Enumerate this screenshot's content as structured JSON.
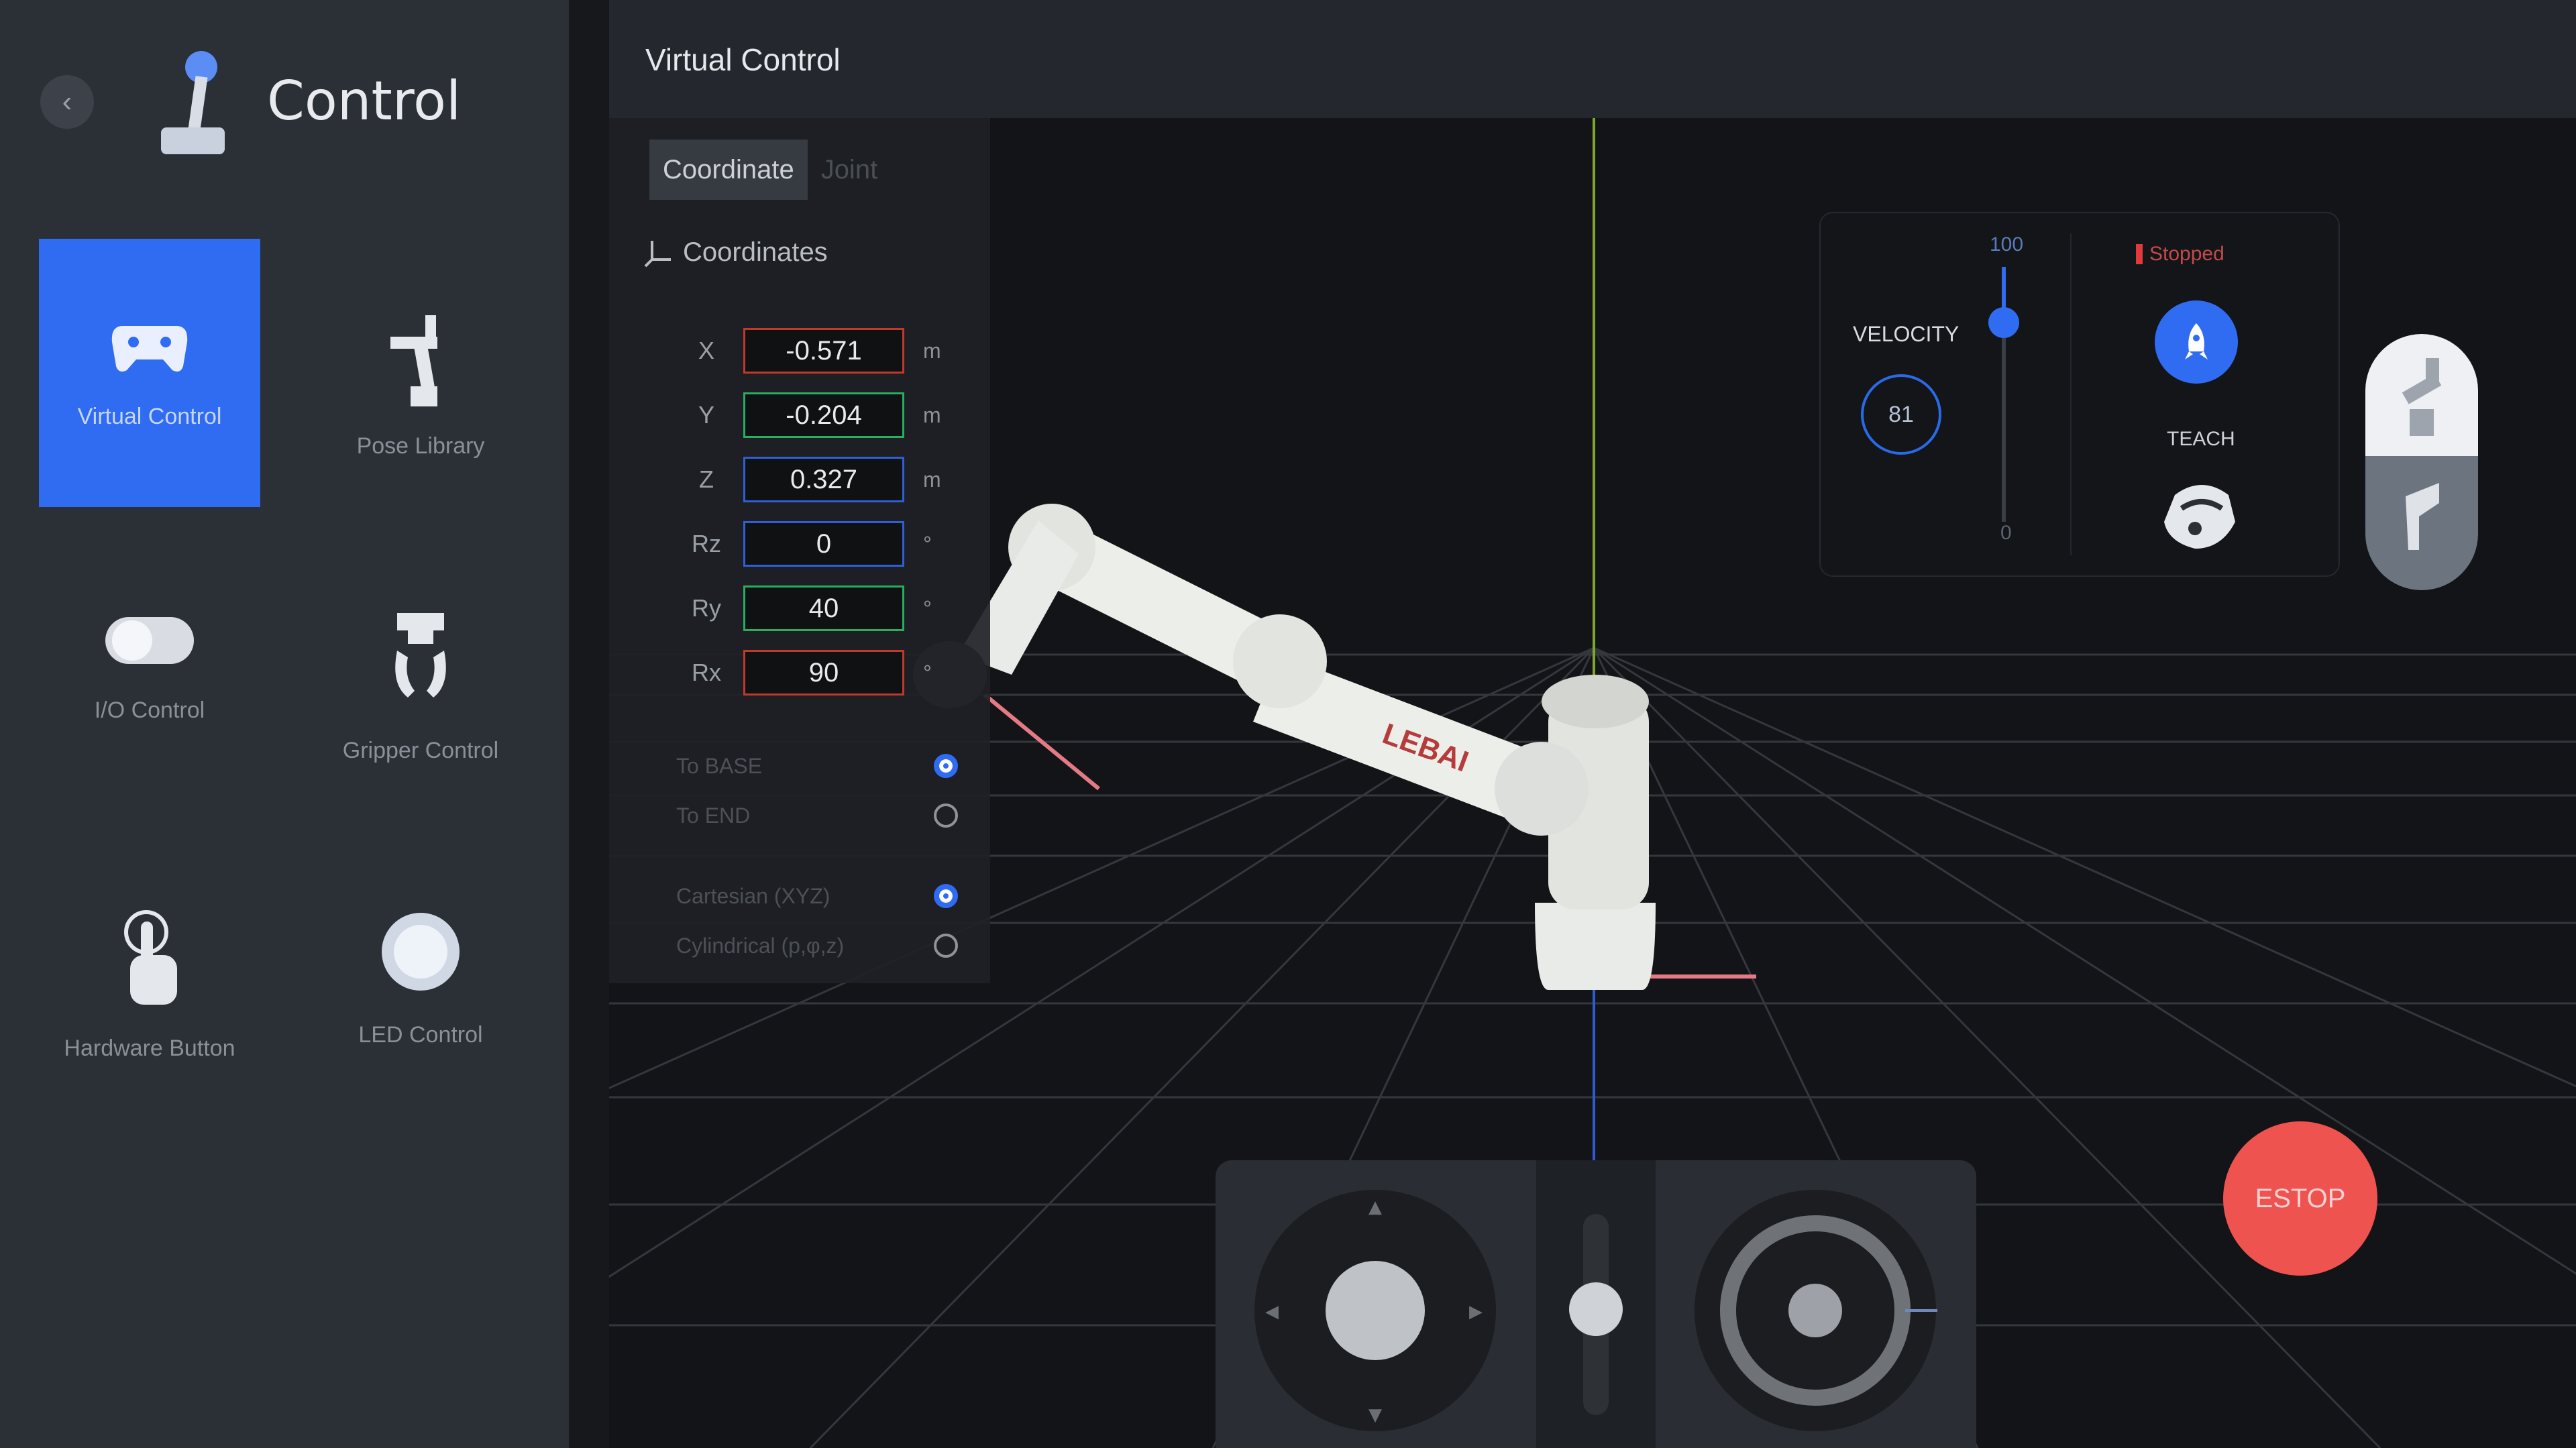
{
  "sidebar": {
    "title": "Control",
    "tiles": [
      {
        "label": "Virtual Control",
        "active": true
      },
      {
        "label": "Pose Library",
        "active": false
      },
      {
        "label": "I/O Control",
        "active": false
      },
      {
        "label": "Gripper Control",
        "active": false
      },
      {
        "label": "Hardware Button",
        "active": false
      },
      {
        "label": "LED Control",
        "active": false
      }
    ]
  },
  "header": {
    "title": "Virtual Control"
  },
  "coord_panel": {
    "tabs": [
      {
        "label": "Coordinate"
      },
      {
        "label": "Joint"
      }
    ],
    "section_title": "Coordinates",
    "fields": [
      {
        "axis": "X",
        "value": "-0.571",
        "unit": "m",
        "color": "#c0392b"
      },
      {
        "axis": "Y",
        "value": "-0.204",
        "unit": "m",
        "color": "#27ae60"
      },
      {
        "axis": "Z",
        "value": "0.327",
        "unit": "m",
        "color": "#2e5fd6"
      },
      {
        "axis": "Rz",
        "value": "0",
        "unit": "°",
        "color": "#2e5fd6"
      },
      {
        "axis": "Ry",
        "value": "40",
        "unit": "°",
        "color": "#27ae60"
      },
      {
        "axis": "Rx",
        "value": "90",
        "unit": "°",
        "color": "#c0392b"
      }
    ],
    "reference": [
      {
        "label": "To BASE",
        "selected": true
      },
      {
        "label": "To END",
        "selected": false
      }
    ],
    "coord_system": [
      {
        "label": "Cartesian (XYZ)",
        "selected": true
      },
      {
        "label": "Cylindrical (p,φ,z)",
        "selected": false
      }
    ]
  },
  "velocity": {
    "label": "VELOCITY",
    "value": "81",
    "slider_max": "100",
    "slider_min": "0",
    "slider_level": 0.81
  },
  "status": {
    "label": "Stopped",
    "color": "#e03a3a"
  },
  "teach": {
    "label": "TEACH"
  },
  "robot": {
    "brand": "LEBAI"
  },
  "estop": {
    "label": "ESTOP"
  },
  "colors": {
    "accent": "#2f6cf2",
    "estop": "#ef5350"
  }
}
